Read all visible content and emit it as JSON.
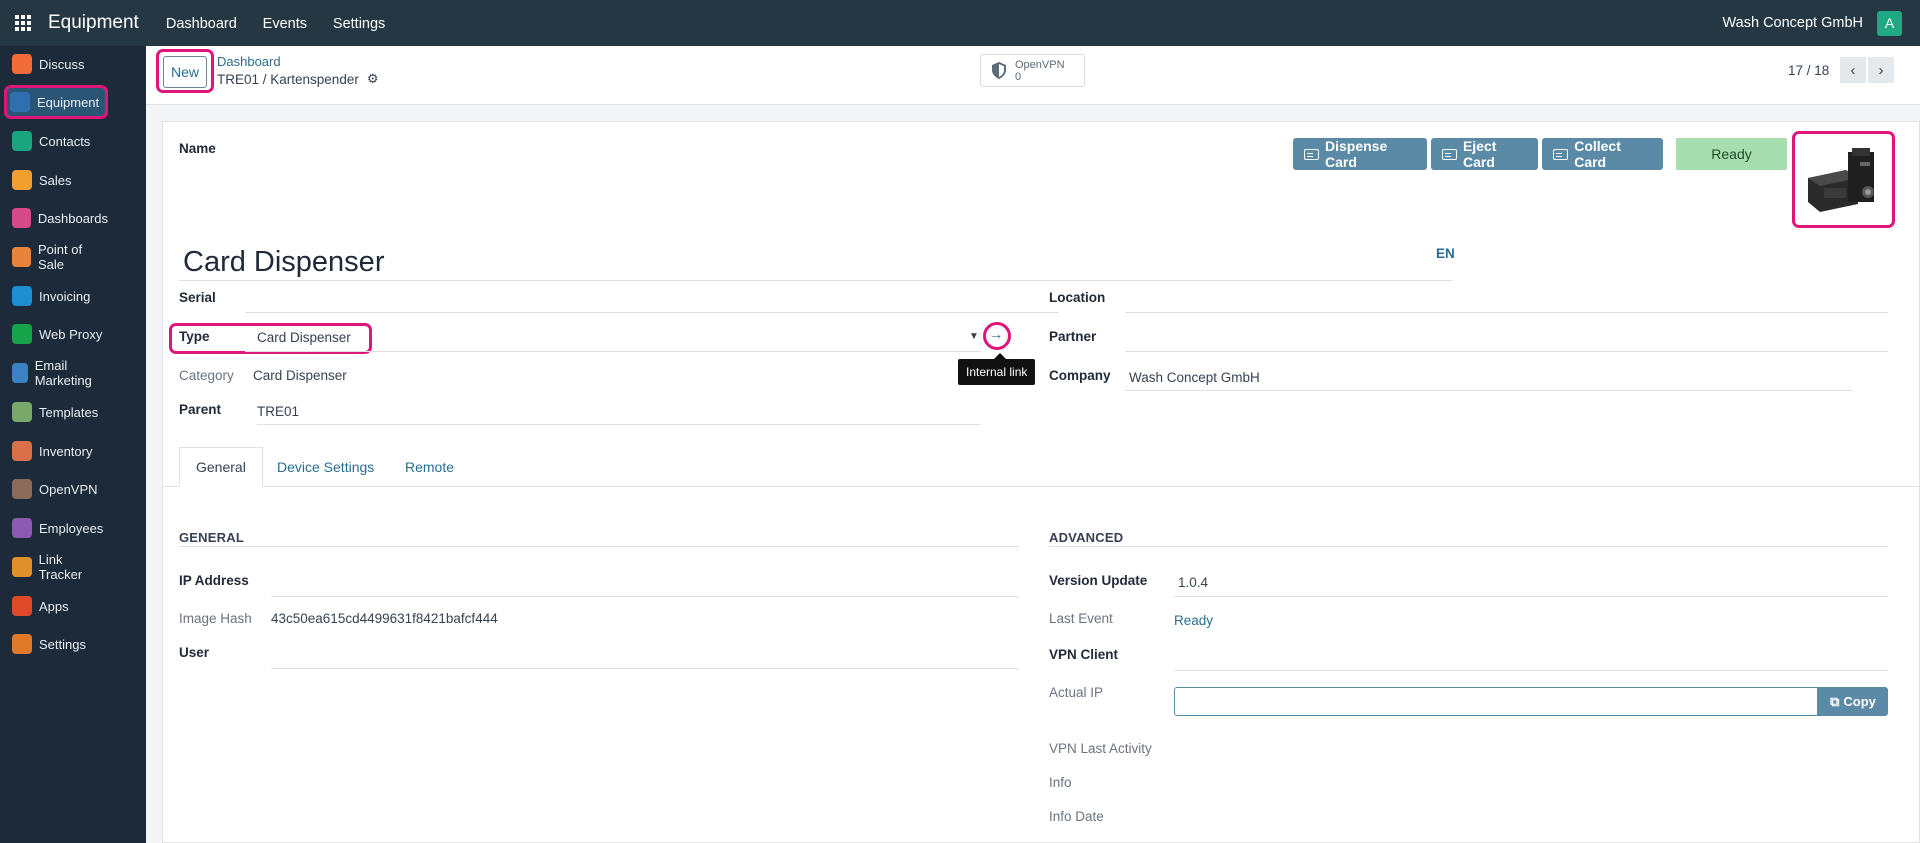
{
  "navbar": {
    "app_title": "Equipment",
    "menu": [
      "Dashboard",
      "Events",
      "Settings"
    ],
    "company": "Wash Concept GmbH",
    "avatar_letter": "A"
  },
  "sidebar": {
    "items": [
      {
        "label": "Discuss",
        "icon": "discuss-icon",
        "color": "#f26b3a"
      },
      {
        "label": "Equipment",
        "icon": "equipment-icon",
        "color": "#2f6fb0",
        "active": true
      },
      {
        "label": "Contacts",
        "icon": "contacts-icon",
        "color": "#1aa57e"
      },
      {
        "label": "Sales",
        "icon": "sales-icon",
        "color": "#f0a030"
      },
      {
        "label": "Dashboards",
        "icon": "dashboards-icon",
        "color": "#d64a8a"
      },
      {
        "label": "Point of Sale",
        "icon": "point-of-sale-icon",
        "color": "#e8843a"
      },
      {
        "label": "Invoicing",
        "icon": "invoicing-icon",
        "color": "#1d8fd0"
      },
      {
        "label": "Web Proxy",
        "icon": "web-proxy-icon",
        "color": "#16a34a"
      },
      {
        "label": "Email Marketing",
        "icon": "email-marketing-icon",
        "color": "#3b82c4"
      },
      {
        "label": "Templates",
        "icon": "templates-icon",
        "color": "#7aa86a"
      },
      {
        "label": "Inventory",
        "icon": "inventory-icon",
        "color": "#d9704a"
      },
      {
        "label": "OpenVPN",
        "icon": "openvpn-icon",
        "color": "#8a6a5a"
      },
      {
        "label": "Employees",
        "icon": "employees-icon",
        "color": "#8a5ab0"
      },
      {
        "label": "Link Tracker",
        "icon": "link-tracker-icon",
        "color": "#e0902a"
      },
      {
        "label": "Apps",
        "icon": "apps-icon",
        "color": "#e0482a"
      },
      {
        "label": "Settings",
        "icon": "settings-icon",
        "color": "#e07a2a"
      }
    ]
  },
  "control_panel": {
    "new_label": "New",
    "breadcrumb": "Dashboard",
    "record_title": "TRE01 / Kartenspender",
    "smart_button": {
      "label": "OpenVPN",
      "count": "0"
    },
    "pager": "17 / 18"
  },
  "form": {
    "name_label": "Name",
    "name_value": "Card Dispenser",
    "lang": "EN",
    "header_buttons": [
      "Dispense Card",
      "Eject Card",
      "Collect Card"
    ],
    "status": "Ready",
    "left_fields": {
      "serial_label": "Serial",
      "type_label": "Type",
      "type_value": "Card Dispenser",
      "category_label": "Category",
      "category_value": "Card Dispenser",
      "parent_label": "Parent",
      "parent_value": "TRE01"
    },
    "right_fields": {
      "location_label": "Location",
      "partner_label": "Partner",
      "company_label": "Company",
      "company_value": "Wash Concept GmbH"
    },
    "tooltip": "Internal link",
    "tabs": [
      "General",
      "Device Settings",
      "Remote"
    ],
    "general": {
      "title": "GENERAL",
      "ip_label": "IP Address",
      "hash_label": "Image Hash",
      "hash_value": "43c50ea615cd4499631f8421bafcf444",
      "user_label": "User"
    },
    "advanced": {
      "title": "ADVANCED",
      "version_label": "Version Update",
      "version_value": "1.0.4",
      "last_event_label": "Last Event",
      "last_event_value": "Ready",
      "vpn_client_label": "VPN Client",
      "actual_ip_label": "Actual IP",
      "copy_label": "Copy",
      "vpn_last_label": "VPN Last Activity",
      "info_label": "Info",
      "info_date_label": "Info Date"
    }
  },
  "colors": {
    "navbar": "#243742",
    "sidebar": "#1c2a3a",
    "highlight": "#e0157a",
    "primary_button": "#5a8aa6",
    "status_ready": "#a8ddb0",
    "link": "#2a6c8f"
  }
}
